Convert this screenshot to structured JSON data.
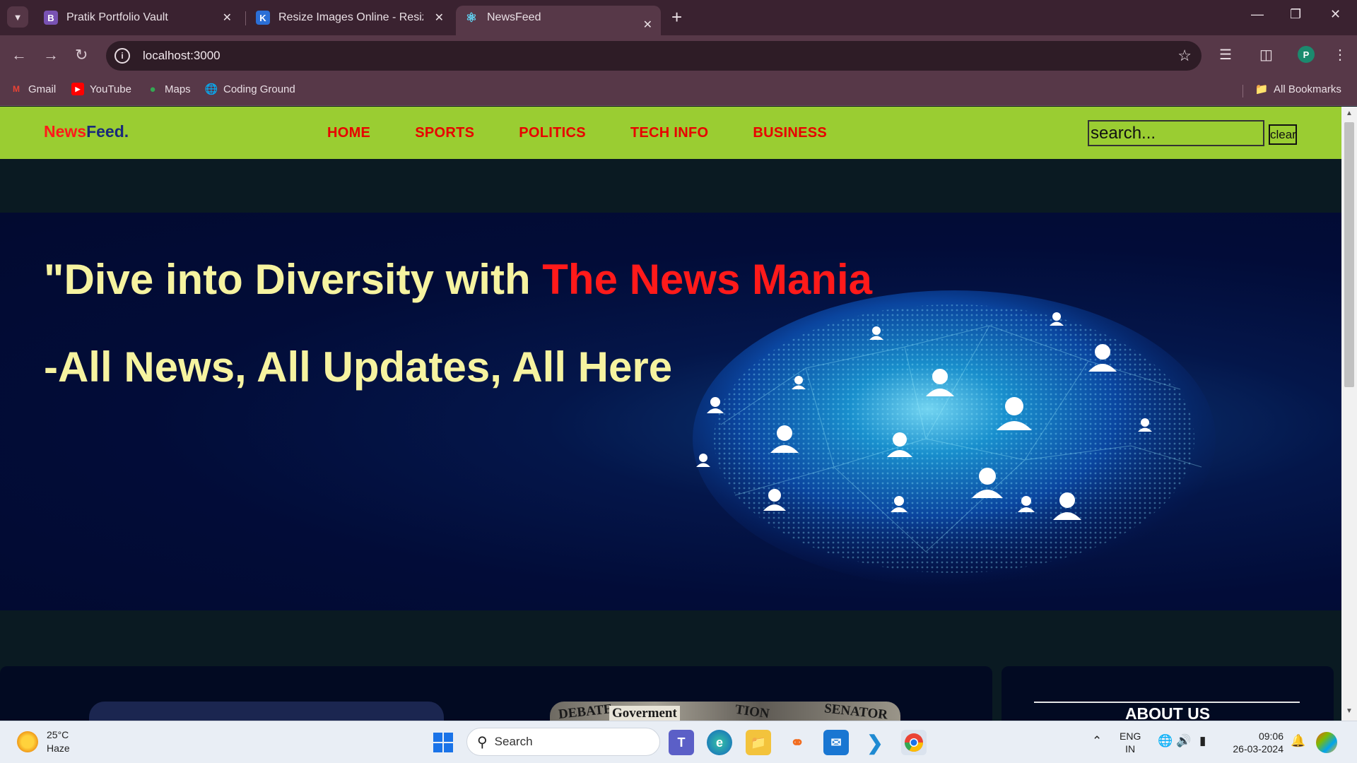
{
  "browser": {
    "tabs": [
      {
        "title": "Pratik Portfolio Vault",
        "favicon": "B"
      },
      {
        "title": "Resize Images Online - Resize JPG",
        "favicon": "K"
      },
      {
        "title": "NewsFeed",
        "favicon": "react-icon"
      }
    ],
    "url": "localhost:3000",
    "profile_initial": "P",
    "bookmarks": [
      {
        "label": "Gmail"
      },
      {
        "label": "YouTube"
      },
      {
        "label": "Maps"
      },
      {
        "label": "Coding Ground"
      }
    ],
    "all_bookmarks": "All Bookmarks"
  },
  "site": {
    "brand_part1": "News",
    "brand_part2": "Feed.",
    "nav": [
      "HOME",
      "SPORTS",
      "POLITICS",
      "TECH INFO",
      "BUSINESS"
    ],
    "search_placeholder": "search...",
    "clear_label": "clear",
    "hero": {
      "line1_prefix": "\"Dive into Diversity with ",
      "line1_highlight": "The News Mania",
      "line2": "-All News, All Updates, All Here"
    },
    "news_image_words": [
      "Goverment",
      "DEBATE",
      "TION",
      "SENATOR"
    ],
    "about_title": "ABOUT US",
    "colors": {
      "navbar": "#9acd32",
      "nav_link": "#e80000",
      "hero_text": "#f6f3a0",
      "hero_highlight": "#ff1a1a"
    }
  },
  "taskbar": {
    "weather_temp": "25°C",
    "weather_desc": "Haze",
    "search_placeholder": "Search",
    "lang_line1": "ENG",
    "lang_line2": "IN",
    "time": "09:06",
    "date": "26-03-2024"
  }
}
